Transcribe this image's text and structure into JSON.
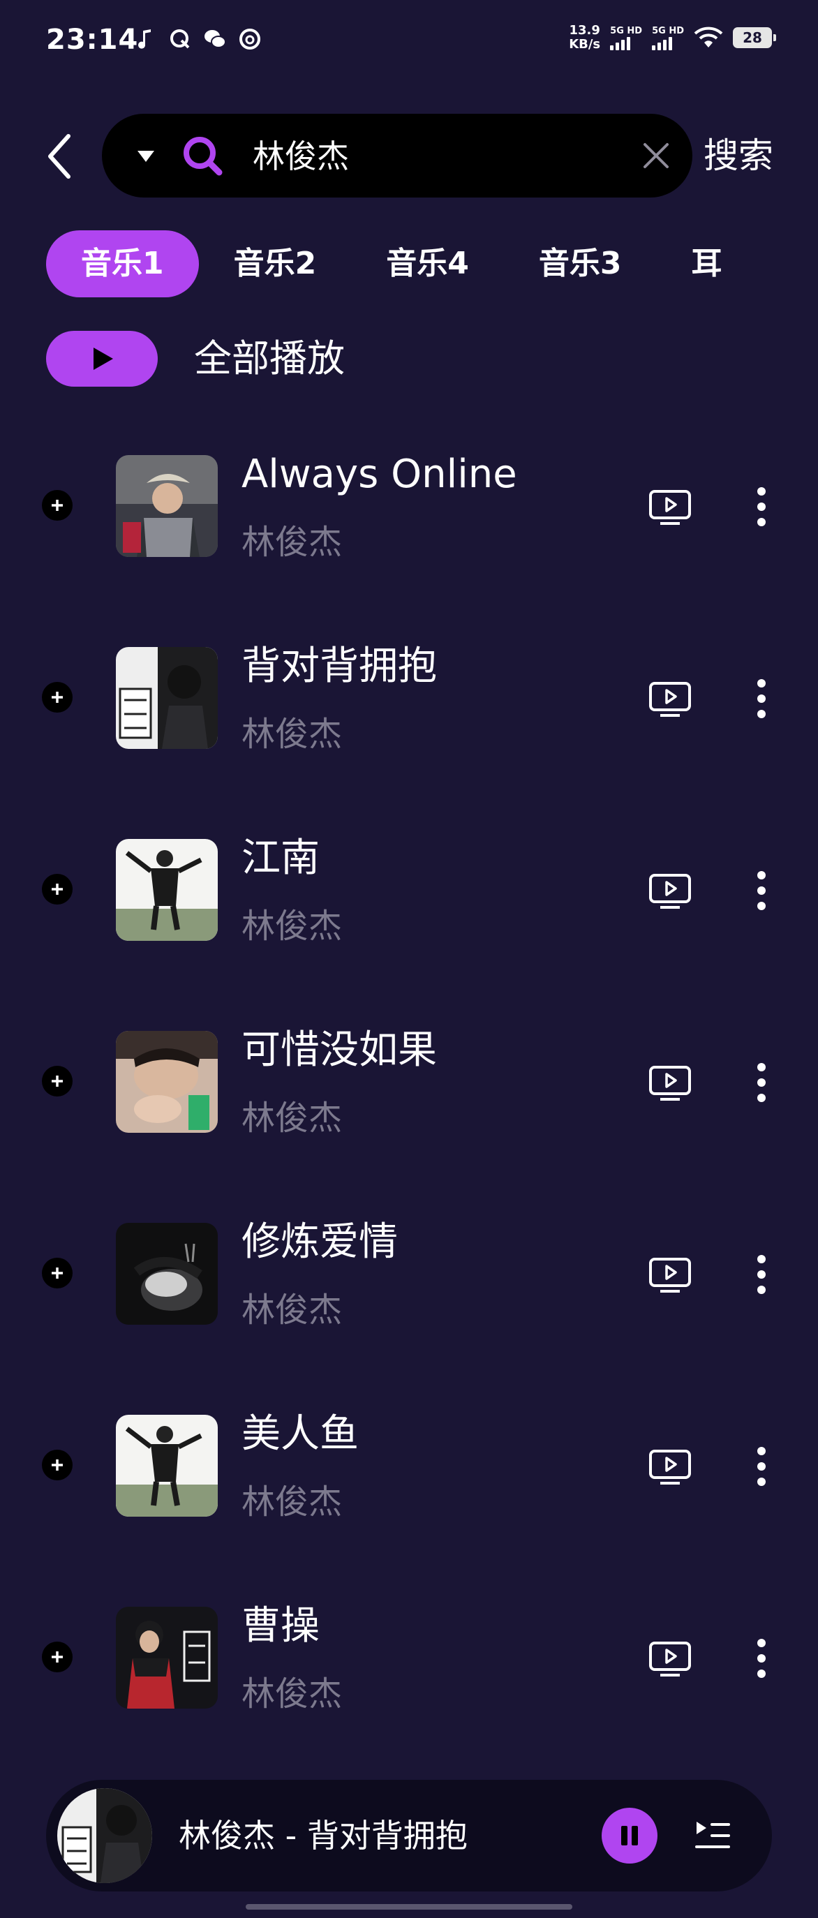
{
  "status_bar": {
    "time": "23:14",
    "net_speed_value": "13.9",
    "net_speed_unit": "KB/s",
    "sim1_label": "5G HD",
    "sim2_label": "5G HD",
    "battery": "28"
  },
  "search": {
    "query": "林俊杰",
    "placeholder": "",
    "button_label": "搜索"
  },
  "tabs": [
    {
      "label": "音乐1",
      "active": true
    },
    {
      "label": "音乐2",
      "active": false
    },
    {
      "label": "音乐4",
      "active": false
    },
    {
      "label": "音乐3",
      "active": false
    },
    {
      "label": "耳",
      "active": false
    }
  ],
  "play_all": {
    "label": "全部播放"
  },
  "songs": [
    {
      "title": "Always Online",
      "artist": "林俊杰"
    },
    {
      "title": "背对背拥抱",
      "artist": "林俊杰"
    },
    {
      "title": "江南",
      "artist": "林俊杰"
    },
    {
      "title": "可惜没如果",
      "artist": "林俊杰"
    },
    {
      "title": "修炼爱情",
      "artist": "林俊杰"
    },
    {
      "title": "美人鱼",
      "artist": "林俊杰"
    },
    {
      "title": "曹操",
      "artist": "林俊杰"
    }
  ],
  "mini_player": {
    "now_playing": "林俊杰 - 背对背拥抱",
    "state": "playing"
  },
  "colors": {
    "background": "#1a1535",
    "accent": "#b045f0",
    "secondary_text": "#7d7a8e",
    "search_bg": "#000000"
  },
  "icons": {
    "back": "chevron-left-icon",
    "dropdown": "triangle-down-icon",
    "search": "search-icon",
    "clear": "close-icon",
    "play": "play-icon",
    "add": "plus-icon",
    "mv": "video-play-icon",
    "more": "more-vertical-icon",
    "pause": "pause-icon",
    "playlist": "playlist-icon"
  }
}
